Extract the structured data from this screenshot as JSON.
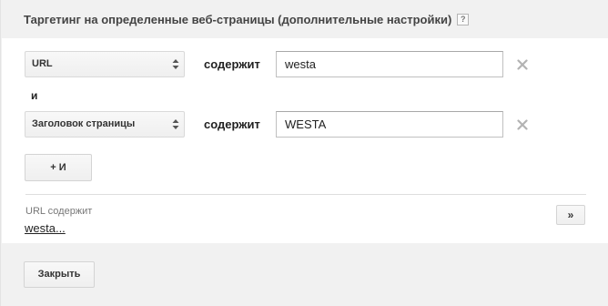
{
  "dialog": {
    "title": "Таргетинг на определенные веб-страницы (дополнительные настройки)",
    "help_icon": "?"
  },
  "rules": [
    {
      "field": "URL",
      "operator": "содержит",
      "value": "westa"
    },
    {
      "field": "Заголовок страницы",
      "operator": "содержит",
      "value": "WESTA"
    }
  ],
  "and_label": "и",
  "add_and_button": "+ И",
  "summary": {
    "label": "URL содержит",
    "value": "westa...",
    "expand_button": "»"
  },
  "footer": {
    "close_button": "Закрыть"
  },
  "icons": {
    "remove": "close-x-icon",
    "select_arrows": "up-down-arrows-icon",
    "help": "question-mark-icon"
  },
  "colors": {
    "header_bg": "#f1f1f1",
    "panel_bg": "#ffffff",
    "remove_icon": "#b3b3b3"
  }
}
